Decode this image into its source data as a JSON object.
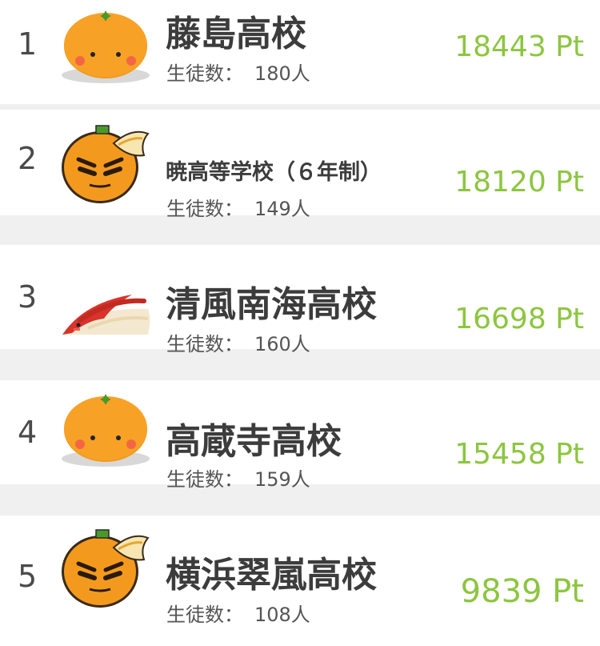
{
  "colors": {
    "points_green": "#8cc63f",
    "text_dark": "#3c3c3c",
    "separator": "#f0f0f0"
  },
  "student_label": "生徒数：",
  "ranking": [
    {
      "rank": "1",
      "name": "藤島高校",
      "students": "180人",
      "points": "18443 Pt",
      "avatar_icon": "smiling-mikan-icon"
    },
    {
      "rank": "2",
      "name": "暁高等学校（６年制）",
      "students": "149人",
      "points": "18120 Pt",
      "avatar_icon": "angry-mikan-icon"
    },
    {
      "rank": "3",
      "name": "清風南海高校",
      "students": "160人",
      "points": "16698 Pt",
      "avatar_icon": "red-crest-bird-icon"
    },
    {
      "rank": "4",
      "name": "高蔵寺高校",
      "students": "159人",
      "points": "15458 Pt",
      "avatar_icon": "smiling-mikan-icon"
    },
    {
      "rank": "5",
      "name": "横浜翠嵐高校",
      "students": "108人",
      "points": "9839 Pt",
      "avatar_icon": "angry-mikan-icon"
    }
  ]
}
